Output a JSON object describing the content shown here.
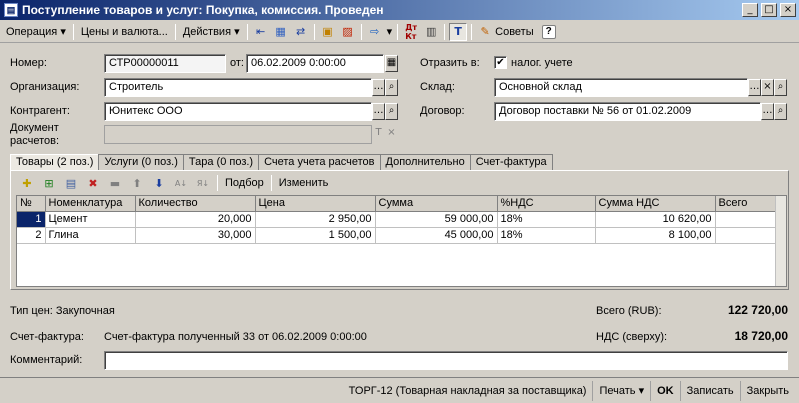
{
  "window": {
    "title": "Поступление товаров и услуг: Покупка, комиссия. Проведен",
    "min": "_",
    "max": "□",
    "close": "×"
  },
  "toolbar": {
    "operation": "Операция",
    "prices": "Цены и валюта...",
    "actions": "Действия",
    "advice": "Советы",
    "help": "?"
  },
  "form": {
    "number_label": "Номер:",
    "number_value": "СТР00000011",
    "date_label": "от:",
    "date_value": "06.02.2009  0:00:00",
    "reflect_label": "Отразить в:",
    "tax_checkbox_label": "налог. учете",
    "tax_checked": "✔",
    "org_label": "Организация:",
    "org_value": "Строитель",
    "warehouse_label": "Склад:",
    "warehouse_value": "Основной склад",
    "counterparty_label": "Контрагент:",
    "counterparty_value": "Юнитекс ООО",
    "contract_label": "Договор:",
    "contract_value": "Договор поставки № 56 от 01.02.2009",
    "settle_doc_label_1": "Документ",
    "settle_doc_label_2": "расчетов:",
    "settle_doc_value": ""
  },
  "tabs": [
    {
      "label": "Товары (2 поз.)",
      "active": true
    },
    {
      "label": "Услуги (0 поз.)"
    },
    {
      "label": "Тара (0 поз.)"
    },
    {
      "label": "Счета учета расчетов"
    },
    {
      "label": "Дополнительно"
    },
    {
      "label": "Счет-фактура"
    }
  ],
  "subtoolbar": {
    "pick": "Подбор",
    "change": "Изменить"
  },
  "table": {
    "columns": [
      "№",
      "Номенклатура",
      "Количество",
      "Цена",
      "Сумма",
      "%НДС",
      "Сумма НДС",
      "Всего"
    ],
    "rows": [
      [
        "1",
        "Цемент",
        "20,000",
        "2 950,00",
        "59 000,00",
        "18%",
        "10 620,00",
        ""
      ],
      [
        "2",
        "Глина",
        "30,000",
        "1 500,00",
        "45 000,00",
        "18%",
        "8 100,00",
        ""
      ]
    ]
  },
  "footer": {
    "price_type": "Тип цен: Закупочная",
    "invoice_label": "Счет-фактура:",
    "invoice_value": "Счет-фактура полученный 33 от 06.02.2009 0:00:00",
    "total_label": "Всего (RUB):",
    "total_value": "122 720,00",
    "vat_label": "НДС (сверху):",
    "vat_value": "18 720,00",
    "comment_label": "Комментарий:",
    "comment_value": ""
  },
  "bottom": {
    "torg": "ТОРГ-12 (Товарная накладная за поставщика)",
    "print": "Печать",
    "ok": "OK",
    "save": "Записать",
    "close": "Закрыть"
  }
}
